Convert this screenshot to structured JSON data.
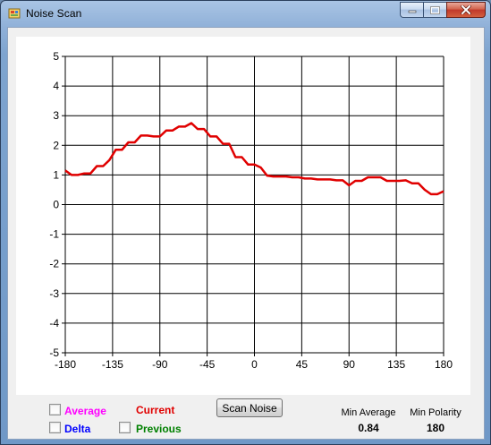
{
  "window": {
    "title": "Noise Scan"
  },
  "chart_data": {
    "type": "line",
    "xlim": [
      -180,
      180
    ],
    "ylim": [
      -5,
      5
    ],
    "x_ticks": [
      "-180",
      "-135",
      "-90",
      "-45",
      "0",
      "45",
      "90",
      "135",
      "180"
    ],
    "y_ticks": [
      "5",
      "4",
      "3",
      "2",
      "1",
      "0",
      "-1",
      "-2",
      "-3",
      "-4",
      "-5"
    ],
    "grid": true,
    "series": [
      {
        "name": "Current",
        "color": "#e00000",
        "x": [
          -180,
          -174,
          -168,
          -162,
          -156,
          -150,
          -144,
          -138,
          -132,
          -126,
          -120,
          -114,
          -108,
          -102,
          -96,
          -90,
          -84,
          -78,
          -72,
          -66,
          -60,
          -54,
          -48,
          -42,
          -36,
          -30,
          -24,
          -18,
          -12,
          -6,
          0,
          6,
          12,
          18,
          24,
          30,
          36,
          42,
          48,
          54,
          60,
          66,
          72,
          78,
          84,
          90,
          96,
          102,
          108,
          114,
          120,
          126,
          132,
          138,
          144,
          150,
          156,
          162,
          168,
          174,
          180
        ],
        "y": [
          1.15,
          1.0,
          1.0,
          1.05,
          1.05,
          1.3,
          1.3,
          1.5,
          1.85,
          1.85,
          2.1,
          2.1,
          2.33,
          2.33,
          2.3,
          2.3,
          2.5,
          2.5,
          2.63,
          2.63,
          2.75,
          2.55,
          2.55,
          2.3,
          2.3,
          2.05,
          2.05,
          1.6,
          1.6,
          1.35,
          1.35,
          1.25,
          0.98,
          0.95,
          0.95,
          0.95,
          0.92,
          0.92,
          0.88,
          0.88,
          0.85,
          0.85,
          0.85,
          0.82,
          0.82,
          0.65,
          0.8,
          0.8,
          0.92,
          0.92,
          0.92,
          0.8,
          0.8,
          0.8,
          0.82,
          0.72,
          0.72,
          0.5,
          0.35,
          0.35,
          0.45
        ]
      }
    ]
  },
  "controls": {
    "average_label": "Average",
    "current_label": "Current",
    "delta_label": "Delta",
    "previous_label": "Previous",
    "scan_button_label": "Scan Noise",
    "min_average_label": "Min Average",
    "min_average_value": "0.84",
    "min_polarity_label": "Min Polarity",
    "min_polarity_value": "180"
  },
  "colors": {
    "average": "#ff00ff",
    "current": "#e00000",
    "delta": "#0000ff",
    "previous": "#008000"
  }
}
